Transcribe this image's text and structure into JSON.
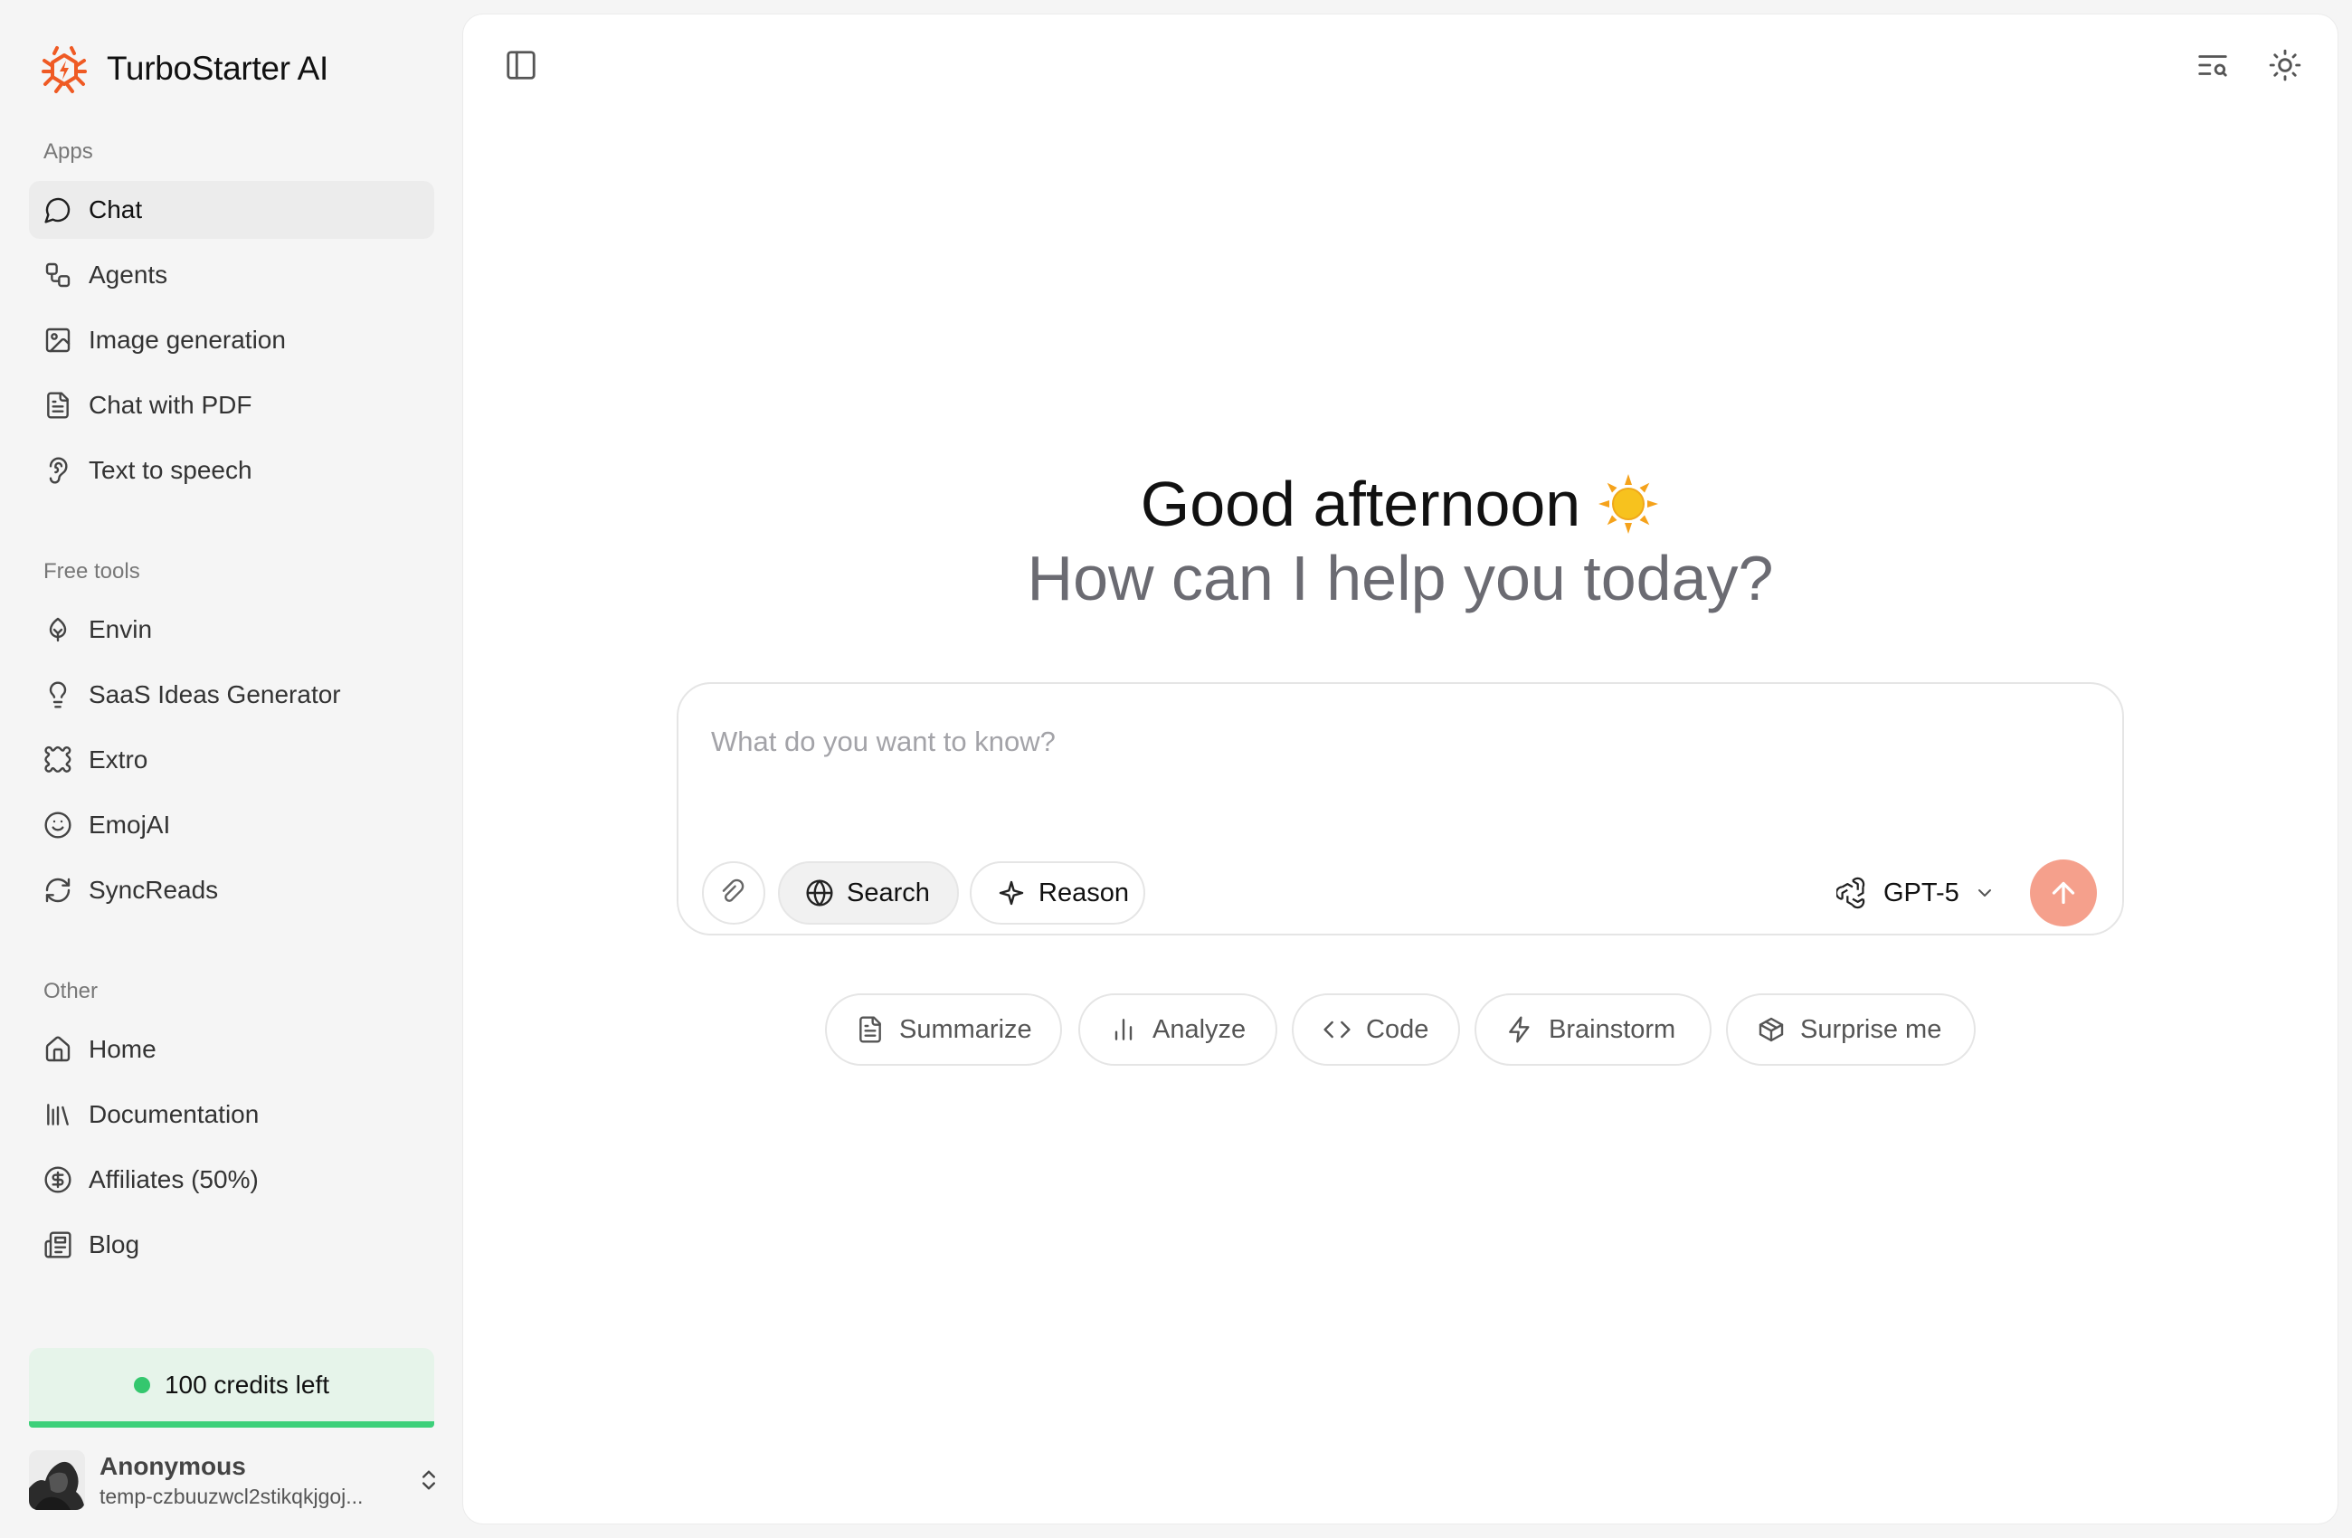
{
  "brand": {
    "name": "TurboStarter AI",
    "accent": "#ef5a24"
  },
  "sidebar": {
    "sections": [
      {
        "label": "Apps"
      },
      {
        "label": "Free tools"
      },
      {
        "label": "Other"
      }
    ],
    "apps": [
      {
        "label": "Chat",
        "icon": "chat-bubble-icon",
        "active": true
      },
      {
        "label": "Agents",
        "icon": "agents-icon"
      },
      {
        "label": "Image generation",
        "icon": "image-icon"
      },
      {
        "label": "Chat with PDF",
        "icon": "document-icon"
      },
      {
        "label": "Text to speech",
        "icon": "speech-icon"
      }
    ],
    "free_tools": [
      {
        "label": "Envin",
        "icon": "leaf-icon"
      },
      {
        "label": "SaaS Ideas Generator",
        "icon": "lightbulb-icon"
      },
      {
        "label": "Extro",
        "icon": "puzzle-icon"
      },
      {
        "label": "EmojAI",
        "icon": "smile-icon"
      },
      {
        "label": "SyncReads",
        "icon": "refresh-icon"
      }
    ],
    "other": [
      {
        "label": "Home",
        "icon": "home-icon"
      },
      {
        "label": "Documentation",
        "icon": "library-icon"
      },
      {
        "label": "Affiliates (50%)",
        "icon": "dollar-icon"
      },
      {
        "label": "Blog",
        "icon": "newspaper-icon"
      }
    ],
    "credits": {
      "label": "100 credits left",
      "color": "#3dd07a"
    },
    "user": {
      "name": "Anonymous",
      "email": "temp-czbuuzwcl2stikqkjgoj..."
    }
  },
  "main": {
    "greeting": "Good afternoon",
    "subheading": "How can I help you today?",
    "composer": {
      "placeholder": "What do you want to know?",
      "search_label": "Search",
      "reason_label": "Reason",
      "model": "GPT-5",
      "send_color": "#f5a08c"
    },
    "suggestions": [
      {
        "label": "Summarize",
        "icon": "document-icon"
      },
      {
        "label": "Analyze",
        "icon": "bar-chart-icon"
      },
      {
        "label": "Code",
        "icon": "code-icon"
      },
      {
        "label": "Brainstorm",
        "icon": "lightning-icon"
      },
      {
        "label": "Surprise me",
        "icon": "box-icon"
      }
    ]
  }
}
